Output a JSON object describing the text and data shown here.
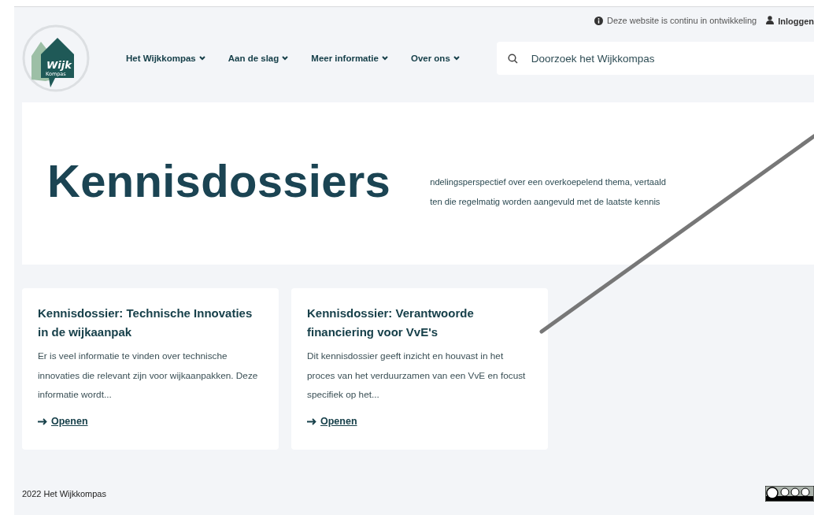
{
  "notice": {
    "text": "Deze website is continu in ontwikkeling"
  },
  "login": {
    "label": "Inloggen"
  },
  "logo": {
    "word": "Wijk",
    "subword": "Kompas"
  },
  "nav": [
    {
      "label": "Het Wijkkompas"
    },
    {
      "label": "Aan de slag"
    },
    {
      "label": "Meer informatie"
    },
    {
      "label": "Over ons"
    }
  ],
  "search": {
    "placeholder": "Doorzoek het Wijkkompas"
  },
  "hero": {
    "title": "Kennisdossiers",
    "lines": [
      "ndelingsperspectief over een overkoepelend thema, vertaald",
      "ten die regelmatig worden aangevuld met de laatste kennis"
    ]
  },
  "cards": [
    {
      "title": "Kennisdossier: Technische Innovaties in de wijkaanpak",
      "text": "Er is veel informatie te vinden over technische innovaties die relevant zijn voor wijkaanpakken. Deze informatie wordt...",
      "link": "Openen"
    },
    {
      "title": "Kennisdossier: Verantwoorde financiering voor VvE's",
      "text": "Dit kennisdossier geeft inzicht en houvast in het proces van het verduurzamen van een VvE en focust specifiek op het...",
      "link": "Openen"
    }
  ],
  "footer": {
    "copyright": "2022 Het Wijkkompas"
  }
}
